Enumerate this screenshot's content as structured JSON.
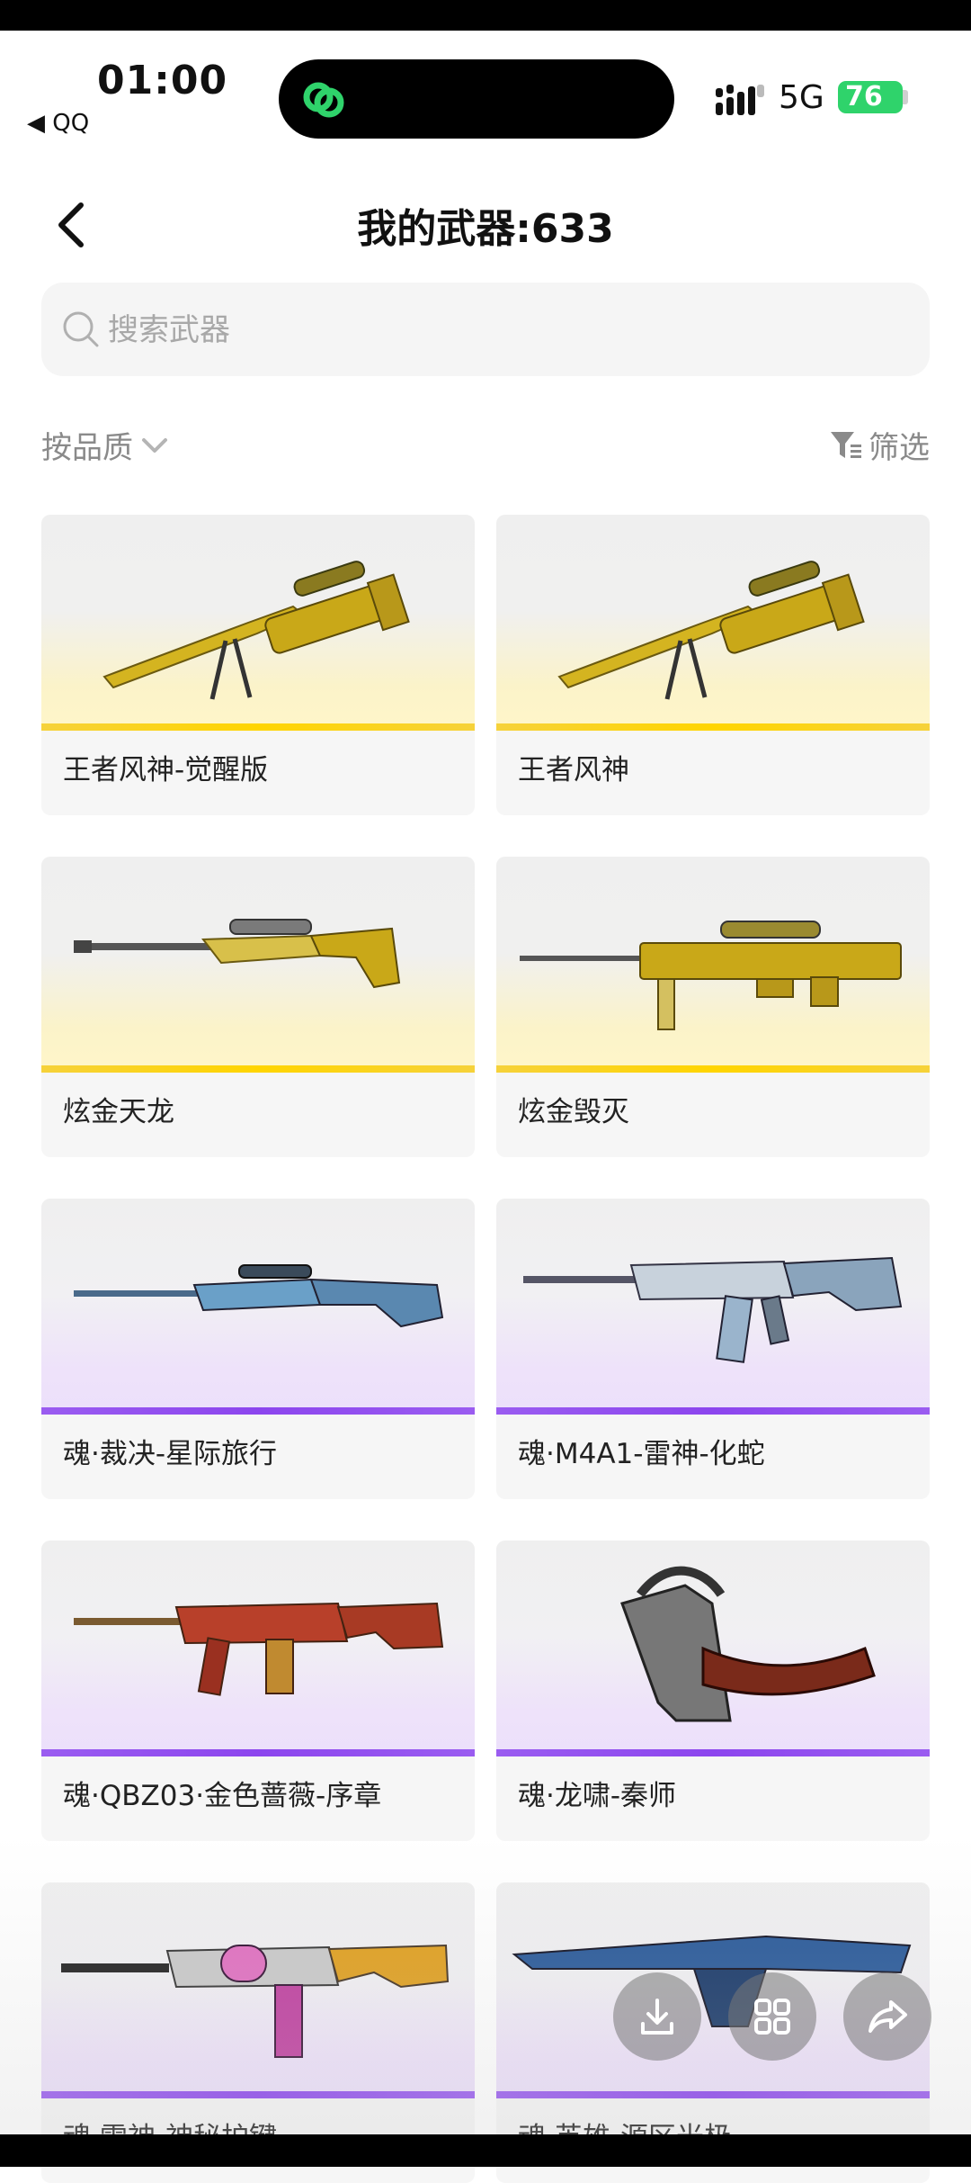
{
  "status_bar": {
    "time": "01:00",
    "back_app": "◀ QQ",
    "network": "5G",
    "battery": "76"
  },
  "header": {
    "title": "我的武器:633"
  },
  "search": {
    "placeholder": "搜索武器"
  },
  "filters": {
    "sort_label": "按品质",
    "filter_label": "筛选"
  },
  "weapons": [
    {
      "name": "王者风神-觉醒版",
      "quality": "gold"
    },
    {
      "name": "王者风神",
      "quality": "gold"
    },
    {
      "name": "炫金天龙",
      "quality": "gold"
    },
    {
      "name": "炫金毁灭",
      "quality": "gold"
    },
    {
      "name": "魂·裁决-星际旅行",
      "quality": "purple"
    },
    {
      "name": "魂·M4A1-雷神-化蛇",
      "quality": "purple"
    },
    {
      "name": "魂·QBZ03·金色蔷薇-序章",
      "quality": "purple"
    },
    {
      "name": "魂·龙啸-秦师",
      "quality": "purple"
    },
    {
      "name": "魂·雷神-神秘护键",
      "quality": "purple"
    },
    {
      "name": "魂·英雄-源区光极",
      "quality": "purple"
    }
  ],
  "colors": {
    "gold_bar": "#ffd500",
    "purple_bar": "#8c45ee",
    "battery": "#2fd36b"
  },
  "floating_actions": [
    "download-icon",
    "grid-icon",
    "share-icon"
  ]
}
